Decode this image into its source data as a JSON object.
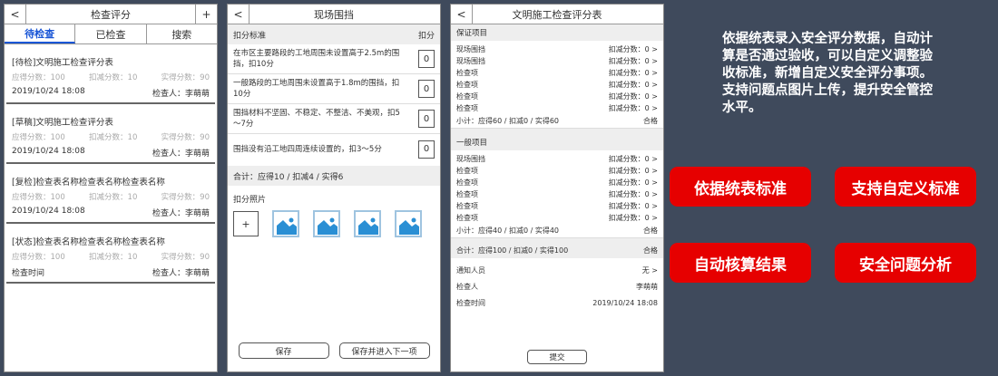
{
  "panel1": {
    "back": "<",
    "title": "检查评分",
    "plus": "+",
    "tabs": [
      "待检查",
      "已检查",
      "搜索"
    ],
    "items": [
      {
        "title": "[待检]文明施工检查评分表",
        "should": "应得分数：100",
        "deduct": "扣减分数：10",
        "actual": "实得分数：90",
        "date": "2019/10/24 18:08",
        "inspector": "检查人：李萌萌"
      },
      {
        "title": "[草稿]文明施工检查评分表",
        "should": "应得分数：100",
        "deduct": "扣减分数：10",
        "actual": "实得分数：90",
        "date": "2019/10/24 18:08",
        "inspector": "检查人：李萌萌"
      },
      {
        "title": "[复检]检查表名称检查表名称检查表名称",
        "should": "应得分数：100",
        "deduct": "扣减分数：10",
        "actual": "实得分数：90",
        "date": "2019/10/24 18:08",
        "inspector": "检查人：李萌萌"
      },
      {
        "title": "[状态]检查表名称检查表名称检查表名称",
        "should": "应得分数：100",
        "deduct": "扣减分数：10",
        "actual": "实得分数：90",
        "date": "检查时间",
        "inspector": "检查人：李萌萌"
      }
    ]
  },
  "panel2": {
    "back": "<",
    "title": "现场围挡",
    "head_left": "扣分标准",
    "head_right": "扣分",
    "criteria": [
      {
        "text": "在市区主要路段的工地周围未设置高于2.5m的围挡，扣10分",
        "score": "0"
      },
      {
        "text": "一般路段的工地周围未设置高于1.8m的围挡，扣10分",
        "score": "0"
      },
      {
        "text": "围挡材料不坚固、不稳定、不整洁、不美观，扣5～7分",
        "score": "0"
      },
      {
        "text": "围挡没有沿工地四周连续设置的，扣3～5分",
        "score": "0"
      }
    ],
    "total": "合计：应得10 / 扣减4 / 实得6",
    "photo_label": "扣分照片",
    "add": "+",
    "save": "保存",
    "save_next": "保存并进入下一项"
  },
  "panel3": {
    "back": "<",
    "title": "文明施工检查评分表",
    "group1": {
      "head": "保证项目",
      "lines": [
        {
          "name": "现场围挡",
          "val": "扣减分数：0 >"
        },
        {
          "name": "现场围挡",
          "val": "扣减分数：0 >"
        },
        {
          "name": "检查项",
          "val": "扣减分数：0 >"
        },
        {
          "name": "检查项",
          "val": "扣减分数：0 >"
        },
        {
          "name": "检查项",
          "val": "扣减分数：0 >"
        },
        {
          "name": "检查项",
          "val": "扣减分数：0 >"
        }
      ],
      "subtotal": "小计：应得60 / 扣减0 / 实得60",
      "status": "合格"
    },
    "group2": {
      "head": "一般项目",
      "lines": [
        {
          "name": "现场围挡",
          "val": "扣减分数：0 >"
        },
        {
          "name": "检查项",
          "val": "扣减分数：0 >"
        },
        {
          "name": "检查项",
          "val": "扣减分数：0 >"
        },
        {
          "name": "检查项",
          "val": "扣减分数：0 >"
        },
        {
          "name": "检查项",
          "val": "扣减分数：0 >"
        },
        {
          "name": "检查项",
          "val": "扣减分数：0 >"
        }
      ],
      "subtotal": "小计：应得40 / 扣减0 / 实得40",
      "status": "合格"
    },
    "sum": "合计：应得100 / 扣减0 / 实得100",
    "sum_status": "合格",
    "notify_label": "通知人员",
    "notify_val": "无 >",
    "inspector_label": "检查人",
    "inspector_val": "李萌萌",
    "time_label": "检查时间",
    "time_val": "2019/10/24 18:08",
    "submit": "提交"
  },
  "description": "依据统表录入安全评分数据，自动计算是否通过验收，可以自定义调整验收标准，新增自定义安全评分事项。支持问题点图片上传，提升安全管控水平。",
  "tags": [
    "依据统表标准",
    "支持自定义标准",
    "自动核算结果",
    "安全问题分析"
  ],
  "colors": {
    "accent": "#1a56d6",
    "tag": "#e60000",
    "background": "#3f4a5c"
  }
}
